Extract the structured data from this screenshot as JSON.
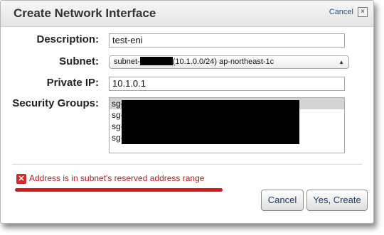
{
  "dialog": {
    "title": "Create Network Interface",
    "cancel_link": "Cancel",
    "close_glyph": "×"
  },
  "form": {
    "description": {
      "label": "Description:",
      "value": "test-eni"
    },
    "subnet": {
      "label": "Subnet:",
      "prefix": "subnet-",
      "suffix": "(10.1.0.0/24) ap-northeast-1c"
    },
    "private_ip": {
      "label": "Private IP:",
      "value": "10.1.0.1"
    },
    "security_groups": {
      "label": "Security Groups:",
      "items": [
        "sg-",
        "sg-",
        "sg-",
        "sg-"
      ]
    }
  },
  "error": {
    "icon": "error-icon",
    "message": "Address is in subnet's reserved address range"
  },
  "buttons": {
    "cancel": "Cancel",
    "create": "Yes, Create"
  },
  "colors": {
    "error_text": "#b11c1c",
    "error_underline": "#e0161b",
    "button_text": "#1a3d6b"
  }
}
